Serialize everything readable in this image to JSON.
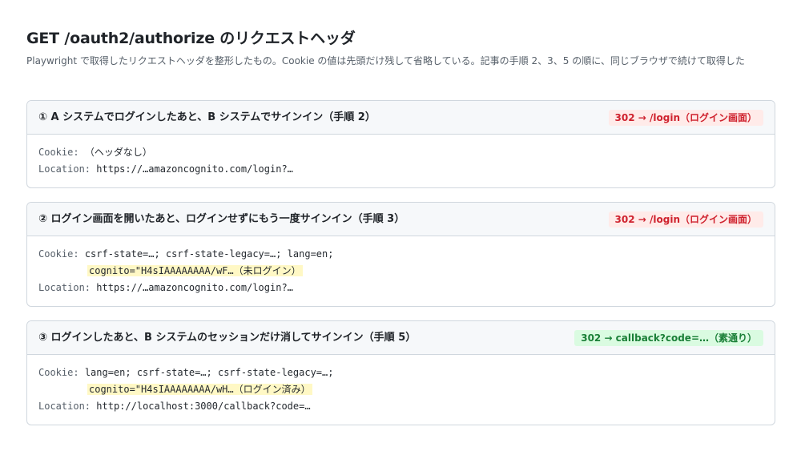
{
  "page": {
    "title": "GET /oauth2/authorize のリクエストヘッダ",
    "description": "Playwright で取得したリクエストヘッダを整形したもの。Cookie の値は先頭だけ残して省略している。記事の手順 2、3、5 の順に、同じブラウザで続けて取得した"
  },
  "cards": [
    {
      "title": "① A システムでログインしたあと、B システムでサインイン（手順 2）",
      "badge": "302 → /login（ログイン画面）",
      "badge_color": "#cf222e",
      "cookie_key": "Cookie:",
      "cookie_value": "（ヘッダなし）",
      "location_key": "Location:",
      "location_value": "https://…amazoncognito.com/login?…"
    },
    {
      "title": "② ログイン画面を開いたあと、ログインせずにもう一度サインイン（手順 3）",
      "badge": "302 → /login（ログイン画面）",
      "badge_color": "#cf222e",
      "cookie_key": "Cookie:",
      "cookie_value": "csrf-state=…; csrf-state-legacy=…; lang=en;",
      "cookie_highlight": "cognito=\"H4sIAAAAAAAA/wF…（未ログイン）",
      "location_key": "Location:",
      "location_value": "https://…amazoncognito.com/login?…"
    },
    {
      "title": "③ ログインしたあと、B システムのセッションだけ消してサインイン（手順 5）",
      "badge": "302 → callback?code=…（素通り）",
      "badge_color": "#1a7f37",
      "cookie_key": "Cookie:",
      "cookie_value": "lang=en; csrf-state=…; csrf-state-legacy=…;",
      "cookie_highlight": "cognito=\"H4sIAAAAAAAA/wH…（ログイン済み）",
      "location_key": "Location:",
      "location_value": "http://localhost:3000/callback?code=…"
    }
  ]
}
